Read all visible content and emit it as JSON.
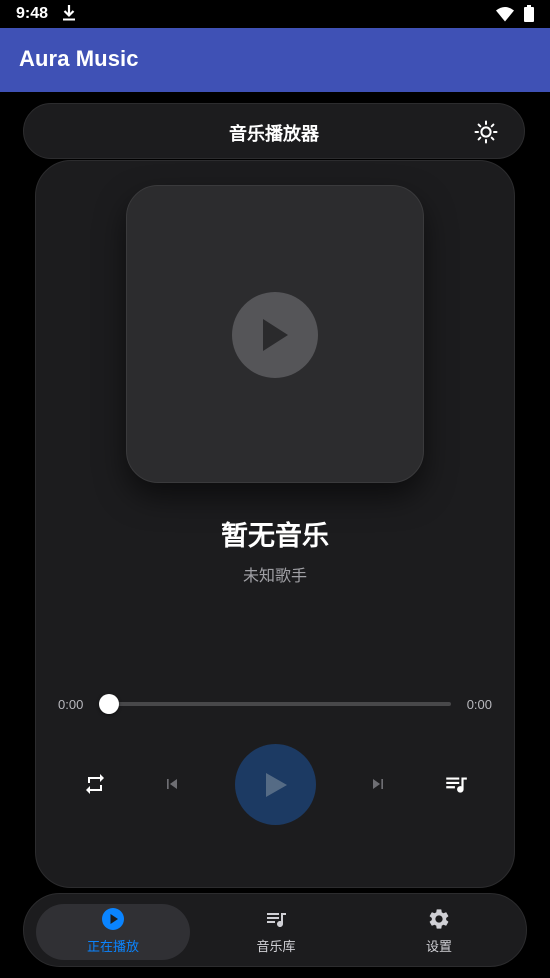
{
  "status_bar": {
    "time": "9:48",
    "icons": [
      "download-icon",
      "wifi-icon",
      "battery-icon"
    ]
  },
  "app_bar": {
    "title": "Aura Music"
  },
  "player_header": {
    "title": "音乐播放器",
    "theme_toggle_icon": "sun-icon"
  },
  "now_playing": {
    "title": "暂无音乐",
    "artist": "未知歌手",
    "current_time": "0:00",
    "total_time": "0:00",
    "progress": 0
  },
  "controls": {
    "repeat_icon": "repeat-icon",
    "prev_icon": "skip-previous-icon",
    "play_icon": "play-icon",
    "next_icon": "skip-next-icon",
    "queue_icon": "queue-music-icon"
  },
  "bottom_nav": {
    "items": [
      {
        "label": "正在播放",
        "icon": "play-circle-icon",
        "active": true
      },
      {
        "label": "音乐库",
        "icon": "library-music-icon",
        "active": false
      },
      {
        "label": "设置",
        "icon": "gear-icon",
        "active": false
      }
    ]
  },
  "colors": {
    "app_bar": "#3f51b5",
    "background": "#000000",
    "card": "#1c1c1e",
    "accent": "#0a84ff",
    "play_button": "#1c3a63"
  }
}
